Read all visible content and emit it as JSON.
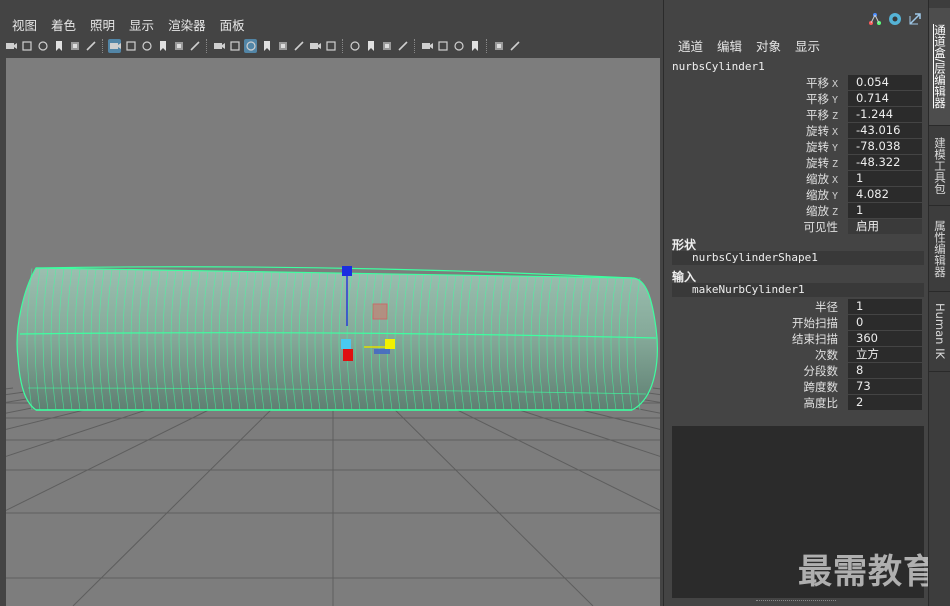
{
  "viewport": {
    "menu": [
      "视图",
      "着色",
      "照明",
      "显示",
      "渲染器",
      "面板"
    ],
    "toolbar_icons": [
      "camera-icon",
      "camera-attr-icon",
      "bookmark-icon",
      "image-plane-icon",
      "grease-pencil-icon",
      "2d-pan-icon",
      "grid-icon",
      "film-gate-icon",
      "resolution-gate-icon",
      "gate-mask-icon",
      "field-chart-icon",
      "safe-action-icon",
      "safe-title-icon",
      "wireframe-icon",
      "smooth-shade-icon",
      "default-material-icon",
      "wireframe-on-shaded-icon",
      "textured-icon",
      "use-all-lights-icon",
      "shadows-icon",
      "screen-space-ao-icon",
      "motion-blur-icon",
      "anti-aliasing-icon",
      "depth-of-field-icon",
      "isolate-select-icon",
      "xray-icon",
      "xray-joints-icon",
      "xray-components-icon",
      "backface-culling-icon",
      "exposure-icon"
    ]
  },
  "channel_box": {
    "menu": [
      "通道",
      "编辑",
      "对象",
      "显示"
    ],
    "object_name": "nurbsCylinder1",
    "transform_attrs": [
      {
        "label": "平移",
        "axis": "X",
        "value": "0.054"
      },
      {
        "label": "平移",
        "axis": "Y",
        "value": "0.714"
      },
      {
        "label": "平移",
        "axis": "Z",
        "value": "-1.244"
      },
      {
        "label": "旋转",
        "axis": "X",
        "value": "-43.016"
      },
      {
        "label": "旋转",
        "axis": "Y",
        "value": "-78.038"
      },
      {
        "label": "旋转",
        "axis": "Z",
        "value": "-48.322"
      },
      {
        "label": "缩放",
        "axis": "X",
        "value": "1"
      },
      {
        "label": "缩放",
        "axis": "Y",
        "value": "4.082"
      },
      {
        "label": "缩放",
        "axis": "Z",
        "value": "1"
      },
      {
        "label": "可见性",
        "axis": "",
        "value": "启用"
      }
    ],
    "shapes_header": "形状",
    "shape_node": "nurbsCylinderShape1",
    "inputs_header": "输入",
    "input_node": "makeNurbCylinder1",
    "input_attrs": [
      {
        "label": "半径",
        "value": "1"
      },
      {
        "label": "开始扫描",
        "value": "0"
      },
      {
        "label": "结束扫描",
        "value": "360"
      },
      {
        "label": "次数",
        "value": "立方"
      },
      {
        "label": "分段数",
        "value": "8"
      },
      {
        "label": "跨度数",
        "value": "73"
      },
      {
        "label": "高度比",
        "value": "2"
      }
    ]
  },
  "side_tabs": [
    "通道盒/层编辑器",
    "建模工具包",
    "属性编辑器",
    "Human IK"
  ],
  "watermark": "最需教育",
  "colors": {
    "wireframe": "#3dffa0",
    "surface": "#8fb3a3",
    "background": "#7d7d7d",
    "panel": "#444444"
  }
}
